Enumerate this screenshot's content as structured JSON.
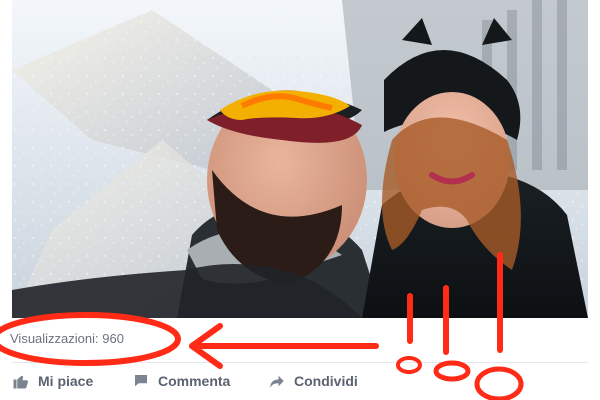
{
  "post": {
    "views_text": "Visualizzazioni: 960"
  },
  "actions": [
    {
      "label": "Mi piace",
      "icon": "like-icon"
    },
    {
      "label": "Commenta",
      "icon": "comment-icon"
    },
    {
      "label": "Condividi",
      "icon": "share-icon"
    }
  ],
  "colors": {
    "annotation_red": "#ff2b17",
    "muted_text": "#6b7280",
    "action_text": "#5b6270"
  }
}
